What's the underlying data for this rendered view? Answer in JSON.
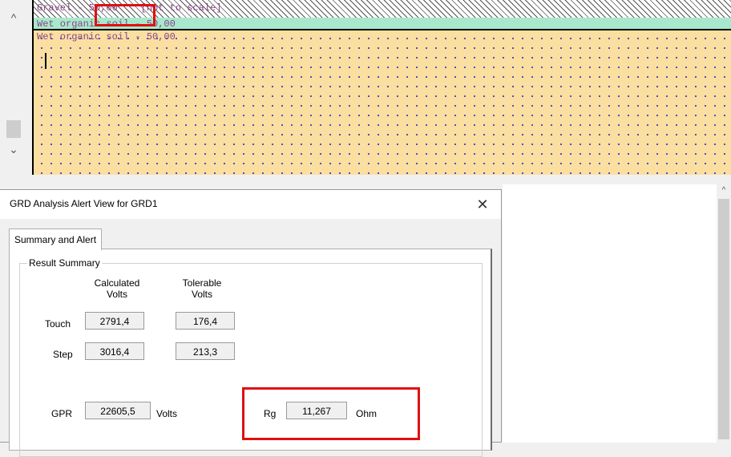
{
  "soil_view": {
    "gravel_label": "Gravel - 50,00    [not to scale]",
    "wet_label": "Wet organic soil - 50,00",
    "wet_label_2": "Wet organic soil - 50,00",
    "colors": {
      "gravel": "#ffffff",
      "wet": "#a8e8cc",
      "sand": "#fbdfa1",
      "dots": "#4a4abf",
      "label": "#8a4488"
    }
  },
  "scrollbar": {
    "up_icon": "chevron-up",
    "down_icon": "chevron-down"
  },
  "dialog": {
    "title": "GRD Analysis Alert View for GRD1",
    "close_glyph": "✕",
    "tab_label": "Summary and Alert",
    "group_label": "Result Summary",
    "columns": {
      "calculated": "Calculated Volts",
      "tolerable": "Tolerable Volts"
    },
    "rows": {
      "touch": {
        "label": "Touch",
        "calculated": "2791,4",
        "tolerable": "176,4"
      },
      "step": {
        "label": "Step",
        "calculated": "3016,4",
        "tolerable": "213,3"
      }
    },
    "gpr": {
      "label": "GPR",
      "value": "22605,5",
      "unit": "Volts"
    },
    "rg": {
      "label": "Rg",
      "value": "11,267",
      "unit": "Ohm"
    }
  },
  "highlight_color": "#e01010"
}
